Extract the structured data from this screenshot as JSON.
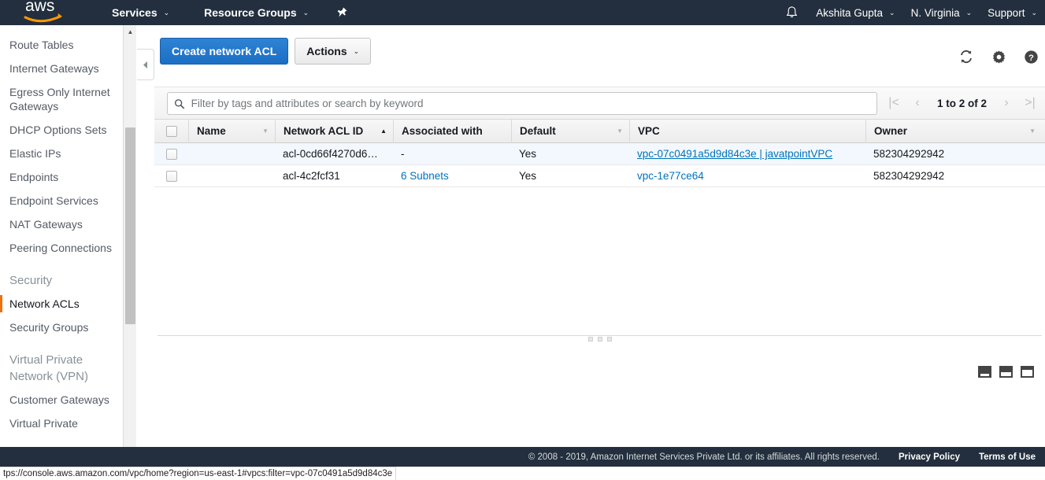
{
  "topnav": {
    "logo_alt": "aws",
    "services_label": "Services",
    "resource_groups_label": "Resource Groups",
    "pin_icon": "pin-icon",
    "bell_icon": "bell-icon",
    "account_label": "Akshita Gupta",
    "region_label": "N. Virginia",
    "support_label": "Support",
    "caret": "⌄"
  },
  "sidebar": {
    "items": [
      {
        "label": "Route Tables",
        "type": "link",
        "active": false
      },
      {
        "label": "Internet Gateways",
        "type": "link",
        "active": false
      },
      {
        "label": "Egress Only Internet Gateways",
        "type": "link",
        "active": false
      },
      {
        "label": "DHCP Options Sets",
        "type": "link",
        "active": false
      },
      {
        "label": "Elastic IPs",
        "type": "link",
        "active": false
      },
      {
        "label": "Endpoints",
        "type": "link",
        "active": false
      },
      {
        "label": "Endpoint Services",
        "type": "link",
        "active": false
      },
      {
        "label": "NAT Gateways",
        "type": "link",
        "active": false
      },
      {
        "label": "Peering Connections",
        "type": "link",
        "active": false
      },
      {
        "label": "Security",
        "type": "heading",
        "active": false
      },
      {
        "label": "Network ACLs",
        "type": "link",
        "active": true
      },
      {
        "label": "Security Groups",
        "type": "link",
        "active": false
      },
      {
        "label": "Virtual Private Network (VPN)",
        "type": "heading",
        "active": false
      },
      {
        "label": "Customer Gateways",
        "type": "link",
        "active": false
      },
      {
        "label": "Virtual Private",
        "type": "link",
        "active": false
      }
    ]
  },
  "toolbar": {
    "create_label": "Create network ACL",
    "actions_label": "Actions",
    "caret": "⌄",
    "refresh_icon": "refresh-icon",
    "settings_icon": "gear-icon",
    "help_icon": "help-icon"
  },
  "filter": {
    "placeholder": "Filter by tags and attributes or search by keyword",
    "value": "",
    "search_icon": "search-icon"
  },
  "pagination": {
    "first_label": "|<",
    "prev_label": "‹",
    "range_label": "1 to 2 of 2",
    "next_label": "›",
    "last_label": ">|"
  },
  "table": {
    "columns": [
      {
        "key": "checkbox",
        "label": "",
        "sort": "none"
      },
      {
        "key": "name",
        "label": "Name",
        "sort": "menu"
      },
      {
        "key": "acl_id",
        "label": "Network ACL ID",
        "sort": "asc"
      },
      {
        "key": "associated_with",
        "label": "Associated with",
        "sort": "none"
      },
      {
        "key": "default",
        "label": "Default",
        "sort": "menu"
      },
      {
        "key": "vpc",
        "label": "VPC",
        "sort": "none"
      },
      {
        "key": "owner",
        "label": "Owner",
        "sort": "menu"
      }
    ],
    "rows": [
      {
        "name": "",
        "acl_id": "acl-0cd66f4270d6…",
        "associated_with": "-",
        "associated_is_link": false,
        "default": "Yes",
        "vpc": "vpc-07c0491a5d9d84c3e | javatpointVPC",
        "vpc_is_link": true,
        "vpc_hovered": true,
        "owner": "582304292942",
        "highlighted": true
      },
      {
        "name": "",
        "acl_id": "acl-4c2fcf31",
        "associated_with": "6 Subnets",
        "associated_is_link": true,
        "default": "Yes",
        "vpc": "vpc-1e77ce64",
        "vpc_is_link": true,
        "vpc_hovered": false,
        "owner": "582304292942",
        "highlighted": false
      }
    ]
  },
  "layout_toggles": [
    {
      "name": "layout-bottom-small"
    },
    {
      "name": "layout-bottom-medium"
    },
    {
      "name": "layout-bottom-large"
    }
  ],
  "footer": {
    "copyright": "© 2008 - 2019, Amazon Internet Services Private Ltd. or its affiliates. All rights reserved.",
    "privacy_label": "Privacy Policy",
    "terms_label": "Terms of Use"
  },
  "statusbar": {
    "url": "tps://console.aws.amazon.com/vpc/home?region=us-east-1#vpcs:filter=vpc-07c0491a5d9d84c3e"
  },
  "colors": {
    "nav_bg": "#232f3e",
    "accent_orange": "#ec7211",
    "primary_blue": "#2f82d4",
    "link_blue": "#0073bb",
    "row_highlight": "#f2f8fd"
  }
}
